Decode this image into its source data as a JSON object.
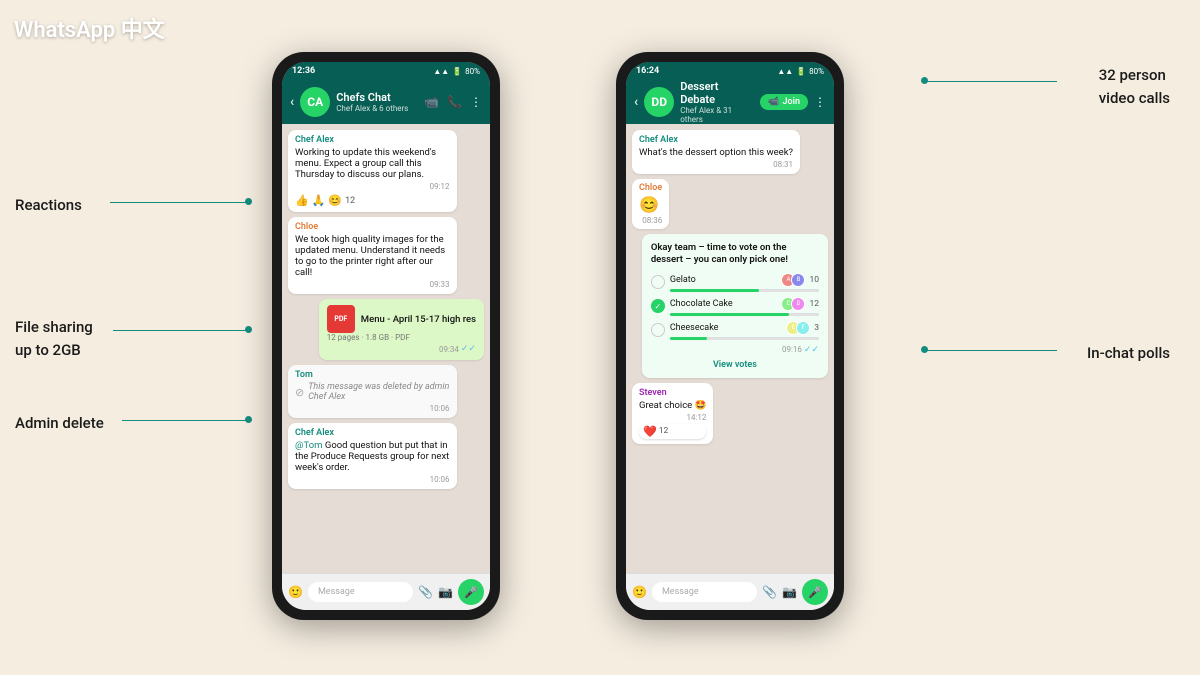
{
  "brand": "WhatsApp 中文",
  "annotations": {
    "reactions": "Reactions",
    "file_sharing": "File sharing\nup to 2GB",
    "admin_delete": "Admin delete",
    "video_calls": "32 person\nvideo calls",
    "in_chat_polls": "In-chat polls"
  },
  "phone_left": {
    "status_bar": {
      "time": "12:36",
      "battery": "80%"
    },
    "header": {
      "name": "Chefs Chat",
      "sub": "Chef Alex & 6 others",
      "has_video": true,
      "has_call": true,
      "has_menu": true
    },
    "messages": [
      {
        "type": "received",
        "sender": "Chef Alex",
        "sender_color": "green",
        "text": "Working to update this weekend's menu. Expect a group call this Thursday to discuss our plans.",
        "time": "09:12",
        "reactions": [
          "👍",
          "🙏",
          "😊"
        ],
        "reaction_count": "12"
      },
      {
        "type": "received",
        "sender": "Chloe",
        "sender_color": "orange",
        "text": "We took high quality images for the updated menu. Understand it needs to go to the printer right after our call!",
        "time": "09:33"
      },
      {
        "type": "file",
        "name": "Menu - April 15-17 high res",
        "meta": "12 pages · 1.8 GB · PDF",
        "time": "09:34",
        "ticks": true
      },
      {
        "type": "deleted",
        "sender": "Tom",
        "text": "This message was deleted by admin Chef Alex",
        "time": "10:06"
      },
      {
        "type": "reply",
        "sender": "Chef Alex",
        "reply_text": "@Tom Good question but put that in the Produce Requests group for next week's order.",
        "time": "10:06",
        "mention": "@Tom"
      }
    ],
    "input_placeholder": "Message"
  },
  "phone_right": {
    "status_bar": {
      "time": "16:24",
      "battery": "80%"
    },
    "header": {
      "name": "Dessert Debate",
      "sub": "Chef Alex & 31 others",
      "has_join": true,
      "join_label": "Join",
      "has_menu": true
    },
    "messages": [
      {
        "type": "received",
        "sender": "Chef Alex",
        "sender_color": "green",
        "text": "What's the dessert option this week?",
        "time": "08:31"
      },
      {
        "type": "received",
        "sender": "Chloe",
        "sender_color": "orange",
        "emoji_only": "😊",
        "time": "08:36"
      },
      {
        "type": "poll",
        "title": "Okay team – time to vote on the dessert – you can only pick one!",
        "options": [
          {
            "text": "Gelato",
            "checked": false,
            "bar_pct": 60,
            "count": 10
          },
          {
            "text": "Chocolate Cake",
            "checked": true,
            "bar_pct": 80,
            "count": 12
          },
          {
            "text": "Cheesecake",
            "checked": false,
            "bar_pct": 25,
            "count": 3
          }
        ],
        "time": "09:16",
        "view_votes": "View votes"
      },
      {
        "type": "received",
        "sender": "Steven",
        "sender_color": "purple",
        "text": "Great choice 🤩",
        "time": "14:12",
        "reaction": "❤️",
        "reaction_count": "12"
      }
    ],
    "input_placeholder": "Message"
  }
}
